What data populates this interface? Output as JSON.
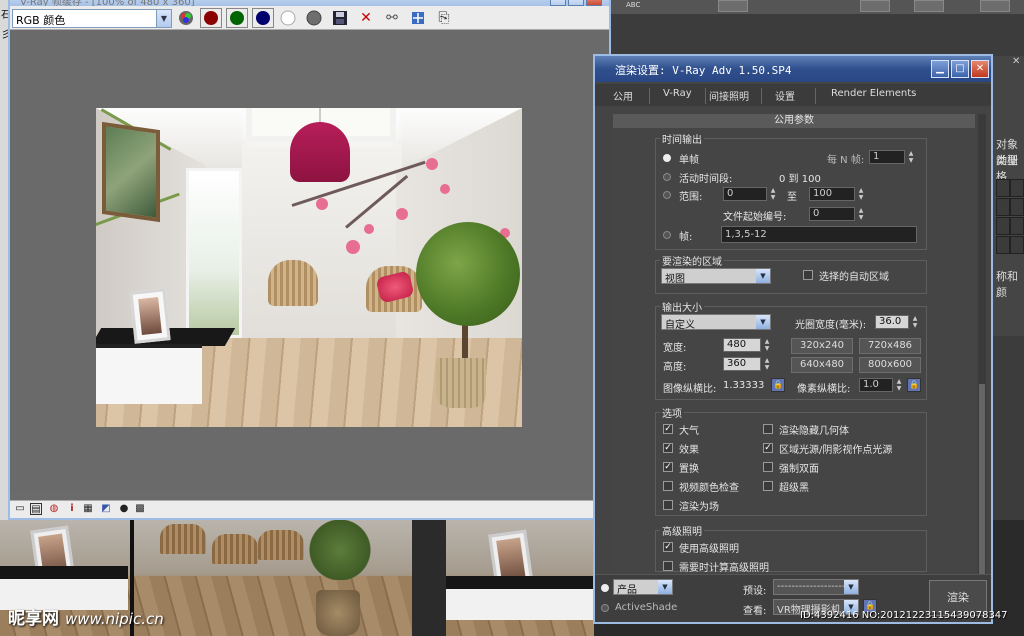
{
  "background": {
    "left_strip_chars": [
      "石",
      "彡"
    ],
    "topbar_text": "ABC",
    "command_panel": {
      "label_1": "对象类型",
      "label_2": "动栅格",
      "label_3": "称和颜"
    }
  },
  "watermark": {
    "brand": "昵享网",
    "url": "www.nipic.cn"
  },
  "image_id": "ID:4392416 NO:20121223115439078347",
  "frame_buffer": {
    "title": "V-Ray 帧缓存 - [100% of 480 x 360]",
    "channel_select": "RGB 颜色",
    "channel_colors": {
      "red": "#8b0000",
      "green": "#006400",
      "blue": "#00006e",
      "white": "#ffffff",
      "gray": "#6e6e6e"
    },
    "toolbar_icons": [
      "save-icon",
      "clear-icon",
      "link-icon",
      "track-mouse-icon",
      "duplicate-icon"
    ],
    "status_icons": [
      "window-icon",
      "rgb-icon",
      "lut-icon",
      "info-icon",
      "levels-icon",
      "curve-icon",
      "sphere-icon",
      "pixel-icon"
    ]
  },
  "render_setup": {
    "title": "渲染设置: V-Ray Adv 1.50.SP4",
    "tabs": [
      "公用",
      "V-Ray",
      "间接照明",
      "设置",
      "Render Elements"
    ],
    "rollout": "公用参数",
    "time_output": {
      "label": "时间输出",
      "single": "单帧",
      "every_n_label": "每 N 帧:",
      "every_n_value": "1",
      "active_segment": "活动时间段:",
      "active_range": "0 到 100",
      "range": "范围:",
      "range_from": "0",
      "range_to_label": "至",
      "range_to": "100",
      "file_number_label": "文件起始编号:",
      "file_number": "0",
      "frames_label": "帧:",
      "frames_value": "1,3,5-12"
    },
    "area": {
      "label": "要渲染的区域",
      "select": "视图",
      "auto_region_label": "选择的自动区域"
    },
    "output_size": {
      "label": "输出大小",
      "select": "自定义",
      "aperture_label": "光圈宽度(毫米):",
      "aperture_value": "36.0",
      "width_label": "宽度:",
      "width_value": "480",
      "height_label": "高度:",
      "height_value": "360",
      "presets": [
        "320x240",
        "720x486",
        "640x480",
        "800x600"
      ],
      "aspect_label": "图像纵横比:",
      "aspect_value": "1.33333",
      "pixel_aspect_label": "像素纵横比:",
      "pixel_aspect_value": "1.0"
    },
    "options": {
      "label": "选项",
      "items": [
        {
          "label": "大气",
          "checked": true
        },
        {
          "label": "渲染隐藏几何体",
          "checked": false
        },
        {
          "label": "效果",
          "checked": true
        },
        {
          "label": "区域光源/阴影视作点光源",
          "checked": true
        },
        {
          "label": "置换",
          "checked": true
        },
        {
          "label": "强制双面",
          "checked": false
        },
        {
          "label": "视频颜色检查",
          "checked": false
        },
        {
          "label": "超级黑",
          "checked": false
        },
        {
          "label": "渲染为场",
          "checked": false
        }
      ]
    },
    "advanced_lighting": {
      "label": "高级照明",
      "use": "使用高级照明",
      "use_checked": true,
      "compute": "需要时计算高级照明",
      "compute_checked": false
    },
    "bottom": {
      "product": "产品",
      "activeshade": "ActiveShade",
      "preset_label": "预设:",
      "preset_value": "--------------------",
      "view_label": "查看:",
      "view_value": "VR物理摄影机",
      "render_button": "渲染"
    }
  }
}
